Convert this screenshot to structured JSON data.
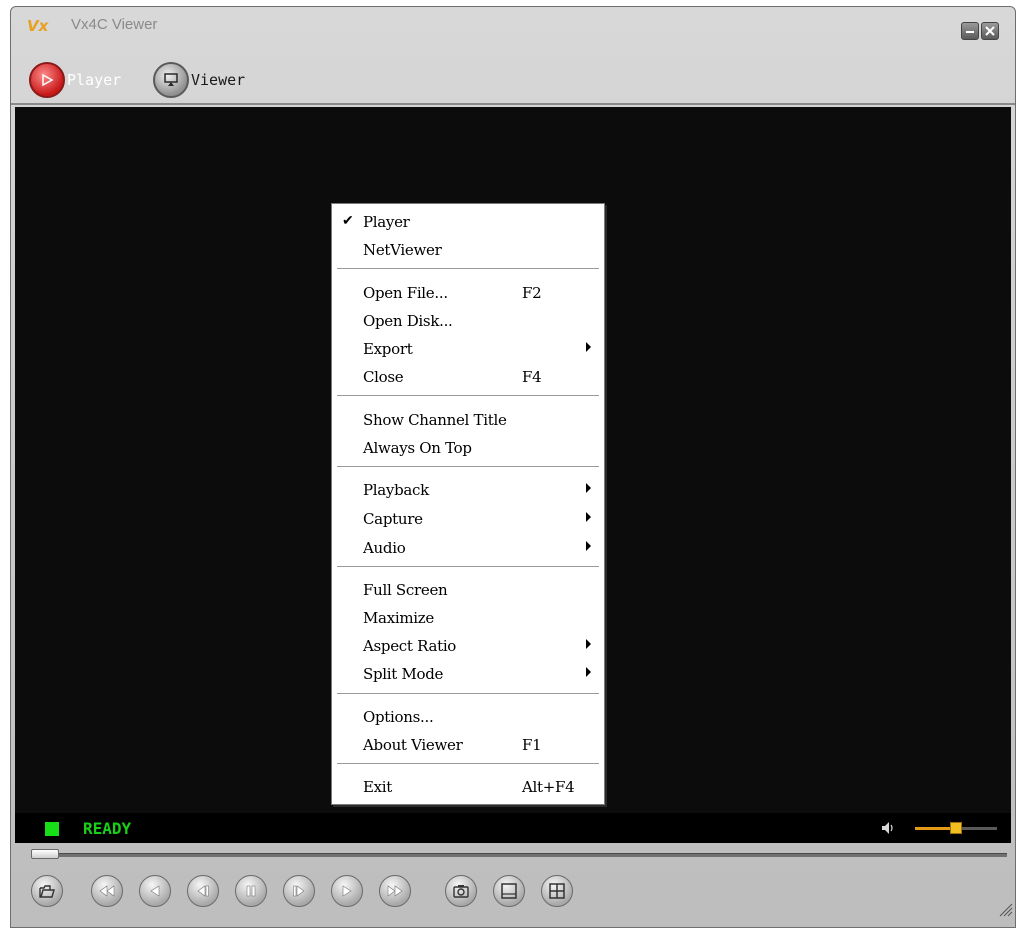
{
  "window": {
    "title": "Vx4C Viewer"
  },
  "modes": {
    "player": "Player",
    "viewer": "Viewer"
  },
  "status": {
    "text": "READY"
  },
  "volume": {
    "level": 0.5
  },
  "seek": {
    "position": 0.0
  },
  "menu": {
    "player": {
      "label": "Player",
      "checked": true
    },
    "netviewer": {
      "label": "NetViewer"
    },
    "open_file": {
      "label": "Open File...",
      "shortcut": "F2"
    },
    "open_disk": {
      "label": "Open Disk..."
    },
    "export": {
      "label": "Export"
    },
    "close": {
      "label": "Close",
      "shortcut": "F4"
    },
    "show_channel_title": {
      "label": "Show Channel Title"
    },
    "always_on_top": {
      "label": "Always On Top"
    },
    "playback": {
      "label": "Playback"
    },
    "capture": {
      "label": "Capture"
    },
    "audio": {
      "label": "Audio"
    },
    "full_screen": {
      "label": "Full Screen"
    },
    "maximize": {
      "label": "Maximize"
    },
    "aspect_ratio": {
      "label": "Aspect Ratio"
    },
    "split_mode": {
      "label": "Split Mode"
    },
    "options": {
      "label": "Options..."
    },
    "about": {
      "label": "About Viewer",
      "shortcut": "F1"
    },
    "exit": {
      "label": "Exit",
      "shortcut": "Alt+F4"
    }
  },
  "controls": [
    "open-file",
    "fast-rewind",
    "rewind",
    "step-back",
    "pause",
    "step-forward",
    "play",
    "fast-forward",
    "snapshot",
    "single-view",
    "quad-view"
  ],
  "colors": {
    "accent_red": "#c81818",
    "status_green": "#18d018",
    "volume_orange": "#e59a17"
  }
}
